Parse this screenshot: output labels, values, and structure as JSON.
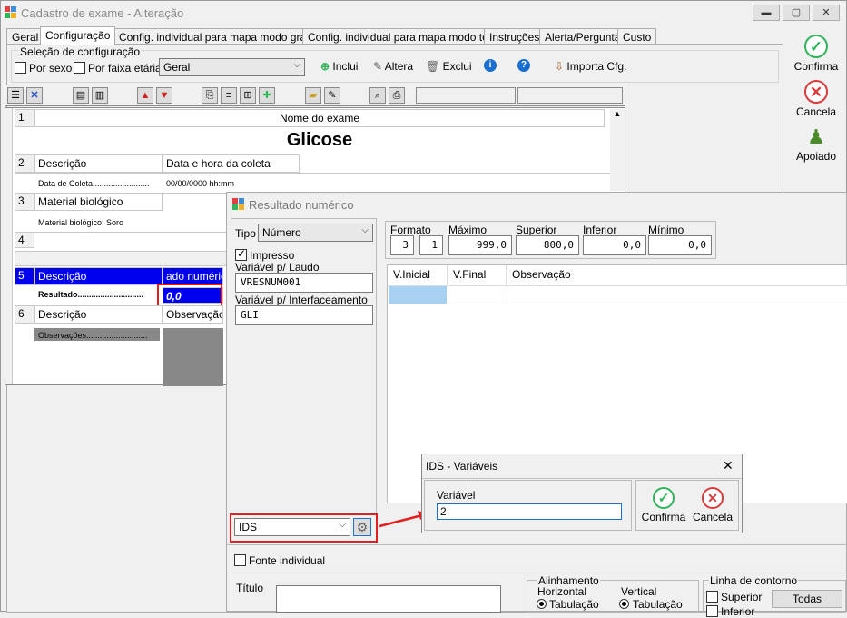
{
  "window": {
    "title": "Cadastro de exame - Alteração",
    "btn_min": "▬",
    "btn_max": "▢",
    "btn_close": "✕"
  },
  "tabs": [
    "Geral",
    "Configuração",
    "Config. individual para mapa modo gráfico",
    "Config. individual para mapa modo texto",
    "Instruções",
    "Alerta/Pergunta",
    "Custo"
  ],
  "config": {
    "group_label": "Seleção de configuração",
    "by_sex": "Por sexo",
    "by_age": "Por faixa etária",
    "combo_value": "Geral",
    "add": "Inclui",
    "edit": "Altera",
    "delete": "Exclui",
    "import": "Importa Cfg."
  },
  "side": {
    "confirm": "Confirma",
    "cancel": "Cancela",
    "support": "Apoiado"
  },
  "grid": {
    "row1_num": "1",
    "row1_header": "Nome do exame",
    "row1_title": "Glicose",
    "row2_num": "2",
    "row2_c1": "Descrição",
    "row2_c2": "Data e hora da coleta",
    "row2_sub1": "Data de Coleta.........................",
    "row2_sub2": "00/00/0000 hh:mm",
    "row3_num": "3",
    "row3_c1": "Material biológico",
    "row3_sub": "Material biológico: Soro",
    "row4_num": "4",
    "row5_num": "5",
    "row5_c1": "Descrição",
    "row5_c2": "ado numérico",
    "row5_sub1": "Resultado.............................",
    "row5_sub2": "0,0",
    "row6_num": "6",
    "row6_c1": "Descrição",
    "row6_c2": "Observação do",
    "row6_sub": "Observações..........................."
  },
  "result": {
    "title": "Resultado numérico",
    "tipo_label": "Tipo",
    "tipo_value": "Número",
    "impresso": "Impresso",
    "var_laudo_label": "Variável p/ Laudo",
    "var_laudo_value": "VRESNUM001",
    "var_interf_label": "Variável p/ Interfaceamento",
    "var_interf_value": "GLI",
    "formato_label": "Formato",
    "formato_int": "3",
    "formato_dec": "1",
    "maximo_label": "Máximo",
    "maximo_value": "999,0",
    "superior_label": "Superior",
    "superior_value": "800,0",
    "inferior_label": "Inferior",
    "inferior_value": "0,0",
    "minimo_label": "Mínimo",
    "minimo_value": "0,0",
    "col_vinicial": "V.Inicial",
    "col_vfinal": "V.Final",
    "col_obs": "Observação",
    "ids_value": "IDS",
    "fonte_individual": "Fonte individual",
    "titulo_label": "Título",
    "alinhamento": "Alinhamento",
    "horizontal": "Horizontal",
    "vertical": "Vertical",
    "tabulacao_h": "Tabulação",
    "tabulacao_v": "Tabulação",
    "linha_contorno": "Linha de contorno",
    "superior_chk": "Superior",
    "inferior_chk": "Inferior",
    "todas": "Todas"
  },
  "dialog": {
    "title": "IDS - Variáveis",
    "var_label": "Variável",
    "var_value": "2",
    "confirm": "Confirma",
    "cancel": "Cancela",
    "close": "✕"
  },
  "colors": {
    "accent_blue": "#0000ee",
    "highlight_red": "#e02020",
    "confirm_green": "#2fb45a",
    "cancel_red": "#d93a3a"
  }
}
